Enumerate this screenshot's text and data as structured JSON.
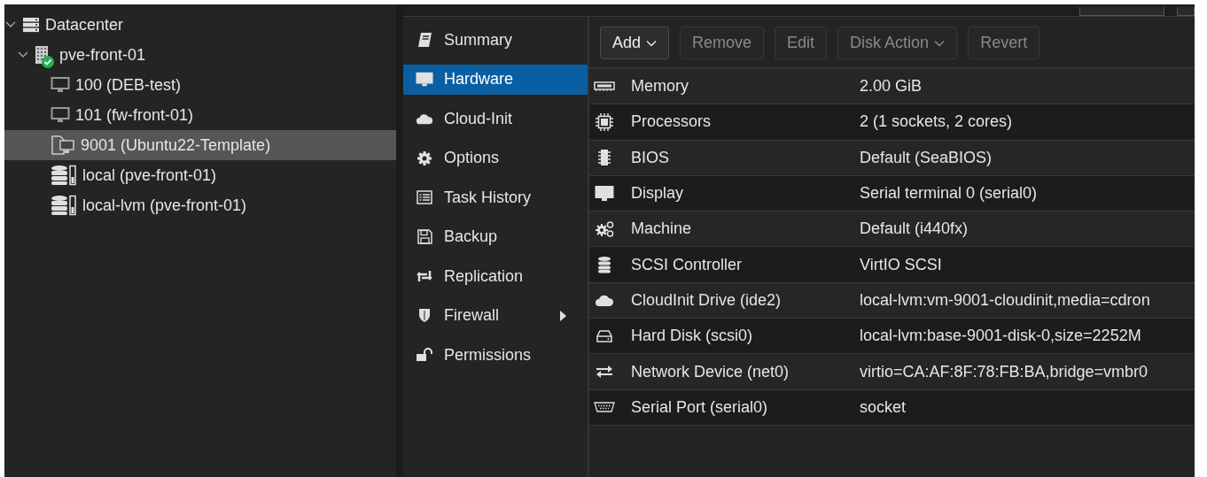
{
  "tree": [
    {
      "label": "Datacenter",
      "kind": "datacenter",
      "expanded": true,
      "selected": false,
      "children": [
        {
          "label": "pve-front-01",
          "kind": "node",
          "online": true,
          "expanded": true,
          "selected": false,
          "children": [
            {
              "label": "100 (DEB-test)",
              "kind": "vm",
              "selected": false
            },
            {
              "label": "101 (fw-front-01)",
              "kind": "vm",
              "selected": false
            },
            {
              "label": "9001 (Ubuntu22-Template)",
              "kind": "template",
              "selected": true
            },
            {
              "label": "local (pve-front-01)",
              "kind": "storage",
              "selected": false
            },
            {
              "label": "local-lvm (pve-front-01)",
              "kind": "storage",
              "selected": false
            }
          ]
        }
      ]
    }
  ],
  "nav": [
    {
      "label": "Summary",
      "kind": "book",
      "selected": false,
      "submenu": false
    },
    {
      "label": "Hardware",
      "kind": "display",
      "selected": true,
      "submenu": false
    },
    {
      "label": "Cloud-Init",
      "kind": "cloud",
      "selected": false,
      "submenu": false
    },
    {
      "label": "Options",
      "kind": "gear",
      "selected": false,
      "submenu": false
    },
    {
      "label": "Task History",
      "kind": "list",
      "selected": false,
      "submenu": false
    },
    {
      "label": "Backup",
      "kind": "floppy",
      "selected": false,
      "submenu": false
    },
    {
      "label": "Replication",
      "kind": "retweet",
      "selected": false,
      "submenu": false
    },
    {
      "label": "Firewall",
      "kind": "shield",
      "selected": false,
      "submenu": true
    },
    {
      "label": "Permissions",
      "kind": "unlock",
      "selected": false,
      "submenu": false
    }
  ],
  "toolbar": [
    {
      "label": "Add",
      "disabled": false,
      "dropdown": true
    },
    {
      "label": "Remove",
      "disabled": true,
      "dropdown": false
    },
    {
      "label": "Edit",
      "disabled": true,
      "dropdown": false
    },
    {
      "label": "Disk Action",
      "disabled": true,
      "dropdown": true
    },
    {
      "label": "Revert",
      "disabled": true,
      "dropdown": false
    }
  ],
  "hardware": [
    {
      "name": "Memory",
      "kind": "memory",
      "value": "2.00 GiB"
    },
    {
      "name": "Processors",
      "kind": "cpu",
      "value": "2 (1 sockets, 2 cores)"
    },
    {
      "name": "BIOS",
      "kind": "bios",
      "value": "Default (SeaBIOS)"
    },
    {
      "name": "Display",
      "kind": "display",
      "value": "Serial terminal 0 (serial0)"
    },
    {
      "name": "Machine",
      "kind": "machine",
      "value": "Default (i440fx)"
    },
    {
      "name": "SCSI Controller",
      "kind": "controller",
      "value": "VirtIO SCSI"
    },
    {
      "name": "CloudInit Drive (ide2)",
      "kind": "cloud",
      "value": "local-lvm:vm-9001-cloudinit,media=cdron"
    },
    {
      "name": "Hard Disk (scsi0)",
      "kind": "disk",
      "value": "local-lvm:base-9001-disk-0,size=2252M"
    },
    {
      "name": "Network Device (net0)",
      "kind": "network",
      "value": "virtio=CA:AF:8F:78:FB:BA,bridge=vmbr0"
    },
    {
      "name": "Serial Port (serial0)",
      "kind": "serial",
      "value": "socket"
    }
  ]
}
